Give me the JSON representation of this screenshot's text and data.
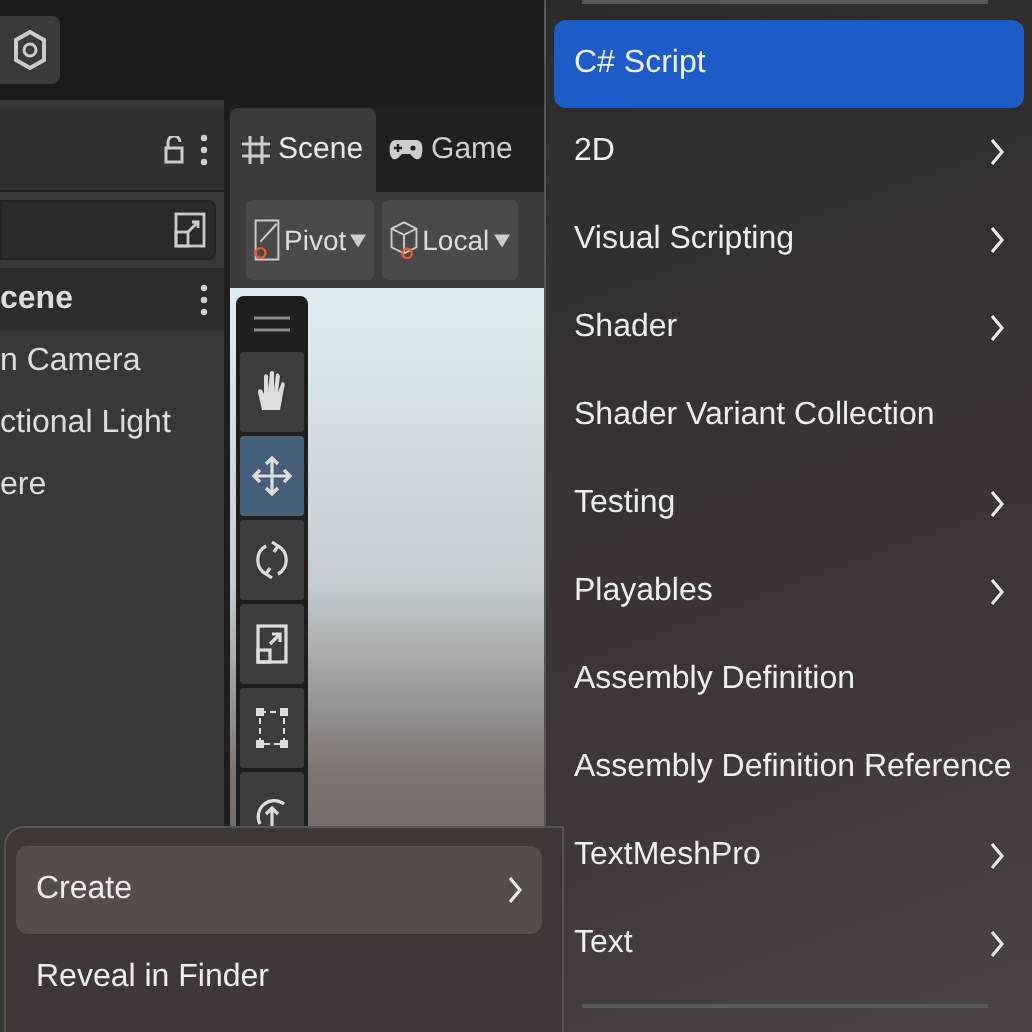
{
  "hierarchy": {
    "items": [
      {
        "label": "cene",
        "kind": "scene"
      },
      {
        "label": "n Camera",
        "kind": "object"
      },
      {
        "label": "ctional Light",
        "kind": "object"
      },
      {
        "label": "ere",
        "kind": "object"
      }
    ]
  },
  "scene_view": {
    "tabs": [
      {
        "label": "Scene",
        "selected": true,
        "kind": "scene"
      },
      {
        "label": "Game",
        "selected": false,
        "kind": "game"
      }
    ],
    "toolbar": [
      {
        "label": "Pivot",
        "kind": "pivot"
      },
      {
        "label": "Local",
        "kind": "local"
      }
    ],
    "tools": [
      {
        "kind": "hand",
        "selected": false
      },
      {
        "kind": "move",
        "selected": true
      },
      {
        "kind": "rotate",
        "selected": false
      },
      {
        "kind": "scale",
        "selected": false
      },
      {
        "kind": "rect",
        "selected": false
      },
      {
        "kind": "transform",
        "selected": false
      }
    ]
  },
  "context_menu": {
    "items": [
      {
        "label": "Create",
        "selected": true,
        "submenu": true
      },
      {
        "label": "Reveal in Finder",
        "selected": false,
        "submenu": false
      }
    ]
  },
  "create_submenu": {
    "items": [
      {
        "label": "C# Script",
        "selected": true,
        "submenu": false
      },
      {
        "label": "2D",
        "selected": false,
        "submenu": true
      },
      {
        "label": "Visual Scripting",
        "selected": false,
        "submenu": true
      },
      {
        "label": "Shader",
        "selected": false,
        "submenu": true
      },
      {
        "label": "Shader Variant Collection",
        "selected": false,
        "submenu": false
      },
      {
        "label": "Testing",
        "selected": false,
        "submenu": true
      },
      {
        "label": "Playables",
        "selected": false,
        "submenu": true
      },
      {
        "label": "Assembly Definition",
        "selected": false,
        "submenu": false
      },
      {
        "label": "Assembly Definition Reference",
        "selected": false,
        "submenu": false
      },
      {
        "label": "TextMeshPro",
        "selected": false,
        "submenu": true
      },
      {
        "label": "Text",
        "selected": false,
        "submenu": true
      }
    ]
  }
}
